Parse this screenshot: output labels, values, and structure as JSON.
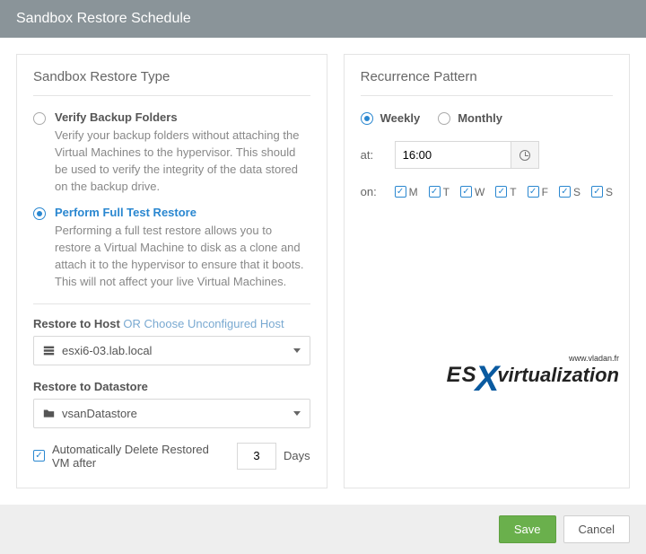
{
  "header": {
    "title": "Sandbox Restore Schedule"
  },
  "left": {
    "panel_title": "Sandbox Restore Type",
    "options": [
      {
        "title": "Verify Backup Folders",
        "desc": "Verify your backup folders without attaching the Virtual Machines to the hypervisor. This should be used to verify the integrity of the data stored on the backup drive.",
        "selected": false
      },
      {
        "title": "Perform Full Test Restore",
        "desc": "Performing a full test restore allows you to restore a Virtual Machine to disk as a clone and attach it to the hypervisor to ensure that it boots. This will not affect your live Virtual Machines.",
        "selected": true
      }
    ],
    "restore_host": {
      "label": "Restore to Host",
      "sublink": "OR Choose Unconfigured Host",
      "value": "esxi6-03.lab.local"
    },
    "restore_ds": {
      "label": "Restore to Datastore",
      "value": "vsanDatastore"
    },
    "auto_delete": {
      "checked": true,
      "label": "Automatically Delete Restored VM after",
      "value": "3",
      "unit": "Days"
    }
  },
  "right": {
    "panel_title": "Recurrence Pattern",
    "frequency": {
      "weekly": "Weekly",
      "monthly": "Monthly",
      "selected": "weekly"
    },
    "at_label": "at:",
    "at_value": "16:00",
    "on_label": "on:",
    "days": [
      {
        "label": "M",
        "checked": true
      },
      {
        "label": "T",
        "checked": true
      },
      {
        "label": "W",
        "checked": true
      },
      {
        "label": "T",
        "checked": true
      },
      {
        "label": "F",
        "checked": true
      },
      {
        "label": "S",
        "checked": true
      },
      {
        "label": "S",
        "checked": true
      }
    ]
  },
  "footer": {
    "save": "Save",
    "cancel": "Cancel"
  },
  "watermark": {
    "tag": "www.vladan.fr",
    "prefix": "ES",
    "x": "X",
    "suffix": "virtualization"
  }
}
